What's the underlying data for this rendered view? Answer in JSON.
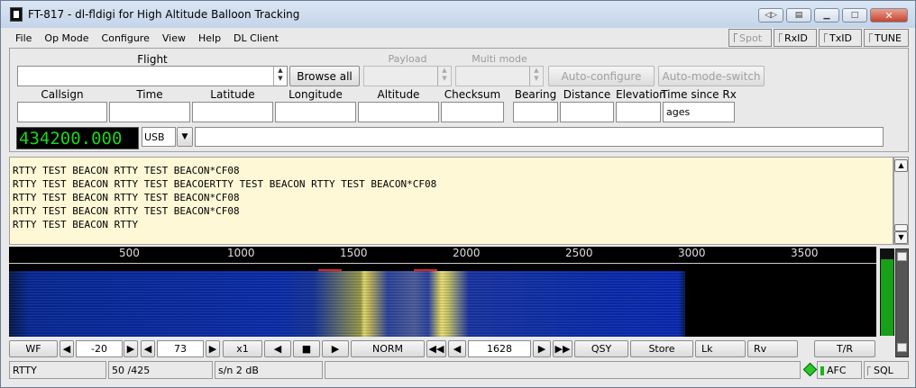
{
  "window": {
    "title": "FT-817 - dl-fldigi for High Altitude Balloon Tracking"
  },
  "menu": {
    "items": [
      {
        "label": "File"
      },
      {
        "label": "Op Mode"
      },
      {
        "label": "Configure"
      },
      {
        "label": "View"
      },
      {
        "label": "Help"
      },
      {
        "label": "DL Client"
      }
    ],
    "toggles": {
      "spot": "Spot",
      "rxid": "RxID",
      "txid": "TxID",
      "tune": "TUNE"
    }
  },
  "flight": {
    "flight_label": "Flight",
    "flight_value": "",
    "browse_label": "Browse all",
    "payload_label": "Payload",
    "multimode_label": "Multi mode",
    "autoconfigure_label": "Auto-configure",
    "automode_label": "Auto-mode-switch"
  },
  "telemetry": {
    "columns": [
      "Callsign",
      "Time",
      "Latitude",
      "Longitude",
      "Altitude",
      "Checksum",
      "Bearing",
      "Distance",
      "Elevation",
      "Time since Rx"
    ],
    "values": [
      "",
      "",
      "",
      "",
      "",
      "",
      "",
      "",
      "",
      "ages"
    ]
  },
  "rig": {
    "frequency": "434200.000",
    "mode": "USB",
    "mode_arrow": "▼",
    "message": ""
  },
  "rx_text": {
    "lines": [
      "RTTY TEST BEACON RTTY TEST BEACON*CF08",
      "RTTY TEST BEACON RTTY TEST BEACOERTTY TEST BEACON RTTY TEST BEACON*CF08",
      "RTTY TEST BEACON RTTY TEST BEACON*CF08",
      "RTTY TEST BEACON RTTY TEST BEACON*CF08",
      "RTTY TEST BEACON RTTY"
    ]
  },
  "waterfall": {
    "scale_ticks": [
      "500",
      "1000",
      "1500",
      "2000",
      "2500",
      "3000",
      "3500"
    ],
    "signal_level": 0.88
  },
  "controls": {
    "wf": "WF",
    "ref_level": "-20",
    "range": "73",
    "zoom": "x1",
    "norm": "NORM",
    "carrier": "1628",
    "qsy": "QSY",
    "store": "Store",
    "lk": "Lk",
    "rv": "Rv",
    "tr": "T/R",
    "left": "◀",
    "right": "▶",
    "stop": "■",
    "fastleft": "◀◀",
    "fastright": "▶▶"
  },
  "status": {
    "mode": "RTTY",
    "shift": "50 /425",
    "snr": "s/n 2  dB",
    "message": "",
    "afc": "AFC",
    "sql": "SQL"
  },
  "colors": {
    "accent_green": "#1fd21f",
    "rx_bg": "#fff8d6",
    "marker_red": "#e02020"
  }
}
